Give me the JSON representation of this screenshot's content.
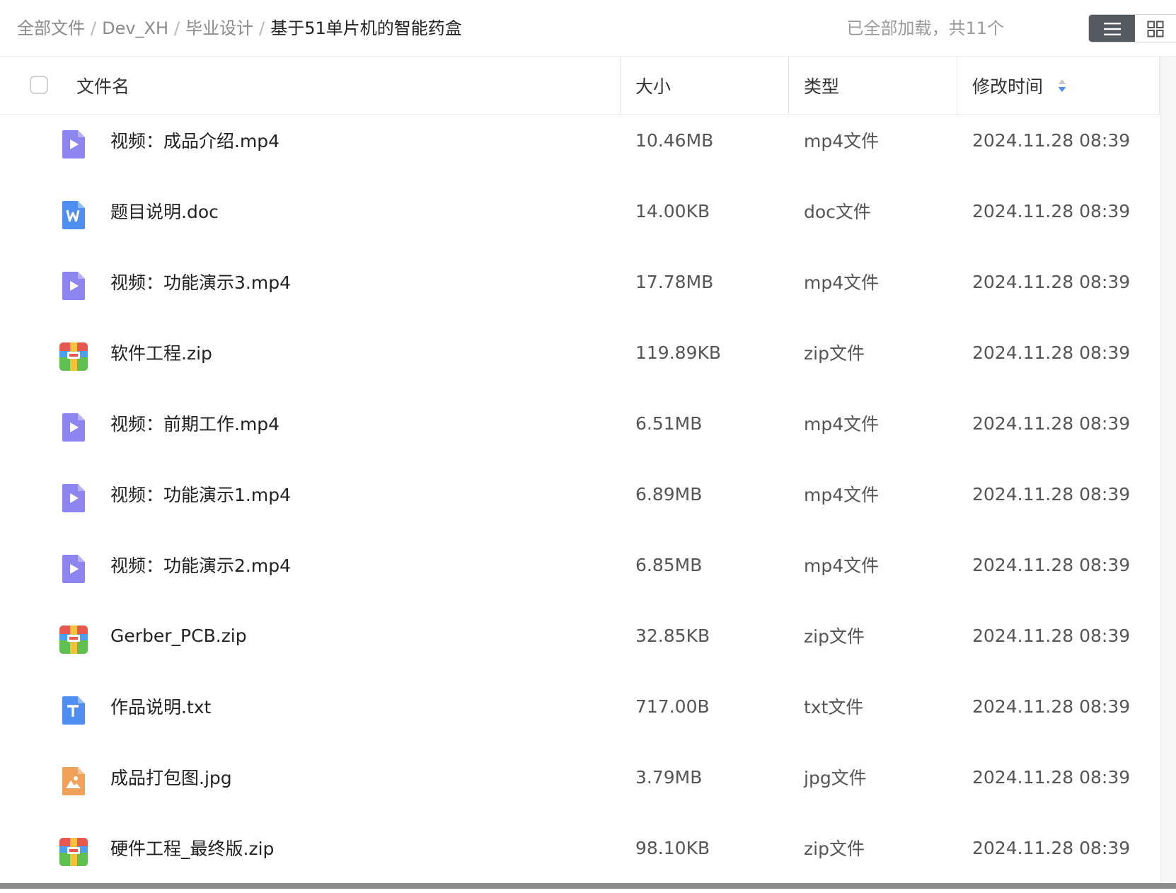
{
  "breadcrumb": {
    "items": [
      "全部文件",
      "Dev_XH",
      "毕业设计"
    ],
    "current": "基于51单片机的智能药盒",
    "separator": "/"
  },
  "load_status": "已全部加载，共11个",
  "view_toggle": {
    "active": "list-view",
    "options": [
      "list-view-icon",
      "grid-view-icon"
    ]
  },
  "columns": {
    "name": "文件名",
    "size": "大小",
    "type": "类型",
    "modified": "修改时间"
  },
  "files": [
    {
      "name": "视频：成品介绍.mp4",
      "size": "10.46MB",
      "type": "mp4文件",
      "modified": "2024.11.28 08:39",
      "icon": "video-file-icon"
    },
    {
      "name": "题目说明.doc",
      "size": "14.00KB",
      "type": "doc文件",
      "modified": "2024.11.28 08:39",
      "icon": "word-file-icon"
    },
    {
      "name": "视频：功能演示3.mp4",
      "size": "17.78MB",
      "type": "mp4文件",
      "modified": "2024.11.28 08:39",
      "icon": "video-file-icon"
    },
    {
      "name": "软件工程.zip",
      "size": "119.89KB",
      "type": "zip文件",
      "modified": "2024.11.28 08:39",
      "icon": "zip-file-icon"
    },
    {
      "name": "视频：前期工作.mp4",
      "size": "6.51MB",
      "type": "mp4文件",
      "modified": "2024.11.28 08:39",
      "icon": "video-file-icon"
    },
    {
      "name": "视频：功能演示1.mp4",
      "size": "6.89MB",
      "type": "mp4文件",
      "modified": "2024.11.28 08:39",
      "icon": "video-file-icon"
    },
    {
      "name": "视频：功能演示2.mp4",
      "size": "6.85MB",
      "type": "mp4文件",
      "modified": "2024.11.28 08:39",
      "icon": "video-file-icon"
    },
    {
      "name": "Gerber_PCB.zip",
      "size": "32.85KB",
      "type": "zip文件",
      "modified": "2024.11.28 08:39",
      "icon": "zip-file-icon"
    },
    {
      "name": "作品说明.txt",
      "size": "717.00B",
      "type": "txt文件",
      "modified": "2024.11.28 08:39",
      "icon": "text-file-icon"
    },
    {
      "name": "成品打包图.jpg",
      "size": "3.79MB",
      "type": "jpg文件",
      "modified": "2024.11.28 08:39",
      "icon": "image-file-icon"
    },
    {
      "name": "硬件工程_最终版.zip",
      "size": "98.10KB",
      "type": "zip文件",
      "modified": "2024.11.28 08:39",
      "icon": "zip-file-icon"
    }
  ],
  "colors": {
    "video": "#8d86f0",
    "word": "#4e8ef0",
    "text": "#4e8ef0",
    "image": "#f0a058",
    "zip_red": "#e8574d",
    "zip_green": "#5fbf4f",
    "zip_blue": "#4a9ff0",
    "zip_yellow": "#f6c23b",
    "sort_active": "#4e8ef0"
  }
}
